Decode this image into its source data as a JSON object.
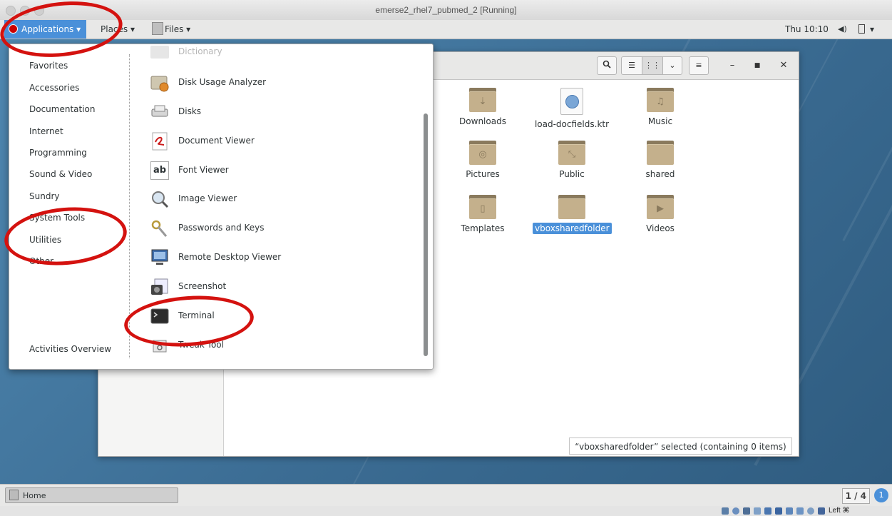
{
  "window": {
    "title": "emerse2_rhel7_pubmed_2 [Running]"
  },
  "topbar": {
    "applications": "Applications ▾",
    "places": "Places ▾",
    "files": "Files ▾",
    "clock": "Thu 10:10",
    "volume_icon": "◀)",
    "power_icon": "▾"
  },
  "menu": {
    "categories": [
      "Favorites",
      "Accessories",
      "Documentation",
      "Internet",
      "Programming",
      "Sound & Video",
      "Sundry",
      "System Tools",
      "Utilities",
      "Other"
    ],
    "footer": "Activities Overview",
    "apps": [
      "Dictionary",
      "Disk Usage Analyzer",
      "Disks",
      "Document Viewer",
      "Font Viewer",
      "Image Viewer",
      "Passwords and Keys",
      "Remote Desktop Viewer",
      "Screenshot",
      "Terminal",
      "Tweak Tool"
    ]
  },
  "files": [
    {
      "name": "Downloads",
      "icon": "download-folder-icon"
    },
    {
      "name": "load-docfields.ktr",
      "icon": "web-document-icon"
    },
    {
      "name": "Music",
      "icon": "music-folder-icon"
    },
    {
      "name": "Pictures",
      "icon": "pictures-folder-icon"
    },
    {
      "name": "Public",
      "icon": "public-folder-icon"
    },
    {
      "name": "shared",
      "icon": "folder-icon"
    },
    {
      "name": "Templates",
      "icon": "templates-folder-icon"
    },
    {
      "name": "vboxsharedfolder",
      "icon": "folder-icon",
      "selected": true
    },
    {
      "name": "Videos",
      "icon": "videos-folder-icon"
    }
  ],
  "status": "“vboxsharedfolder” selected (containing 0 items)",
  "taskbar": {
    "item": "Home",
    "workspace": "1 / 4",
    "notifications": "1"
  },
  "vbox": {
    "host_key": "Left ⌘"
  }
}
